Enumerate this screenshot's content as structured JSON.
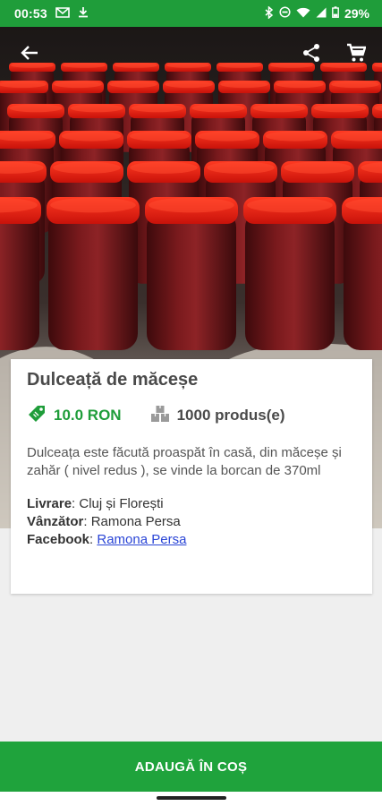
{
  "status_bar": {
    "time": "00:53",
    "battery": "29%",
    "left_icons": [
      "notification-icon",
      "download-icon"
    ],
    "right_icons": [
      "bluetooth-icon",
      "dnd-icon",
      "wifi-icon",
      "signal-icon",
      "battery-icon"
    ]
  },
  "toolbar": {
    "back_icon": "back-arrow-icon",
    "share_icon": "share-icon",
    "cart_icon": "cart-icon"
  },
  "product": {
    "title": "Dulceață de măceșe",
    "price": "10.0 RON",
    "stock": "1000 produs(e)",
    "description": "Dulceața este făcută proaspăt în casă, din măceșe și zahăr ( nivel redus ), se vinde la borcan de 370ml",
    "delivery_label": "Livrare",
    "delivery_value": "Cluj și Florești",
    "seller_label": "Vânzător",
    "seller_value": "Ramona Persa",
    "facebook_label": "Facebook",
    "facebook_value": "Ramona Persa"
  },
  "actions": {
    "add_to_cart": "ADAUGĂ ÎN COȘ"
  },
  "colors": {
    "brand_green": "#1f9d3a",
    "link_blue": "#2a45d6",
    "lid_red": "#e81e10"
  }
}
